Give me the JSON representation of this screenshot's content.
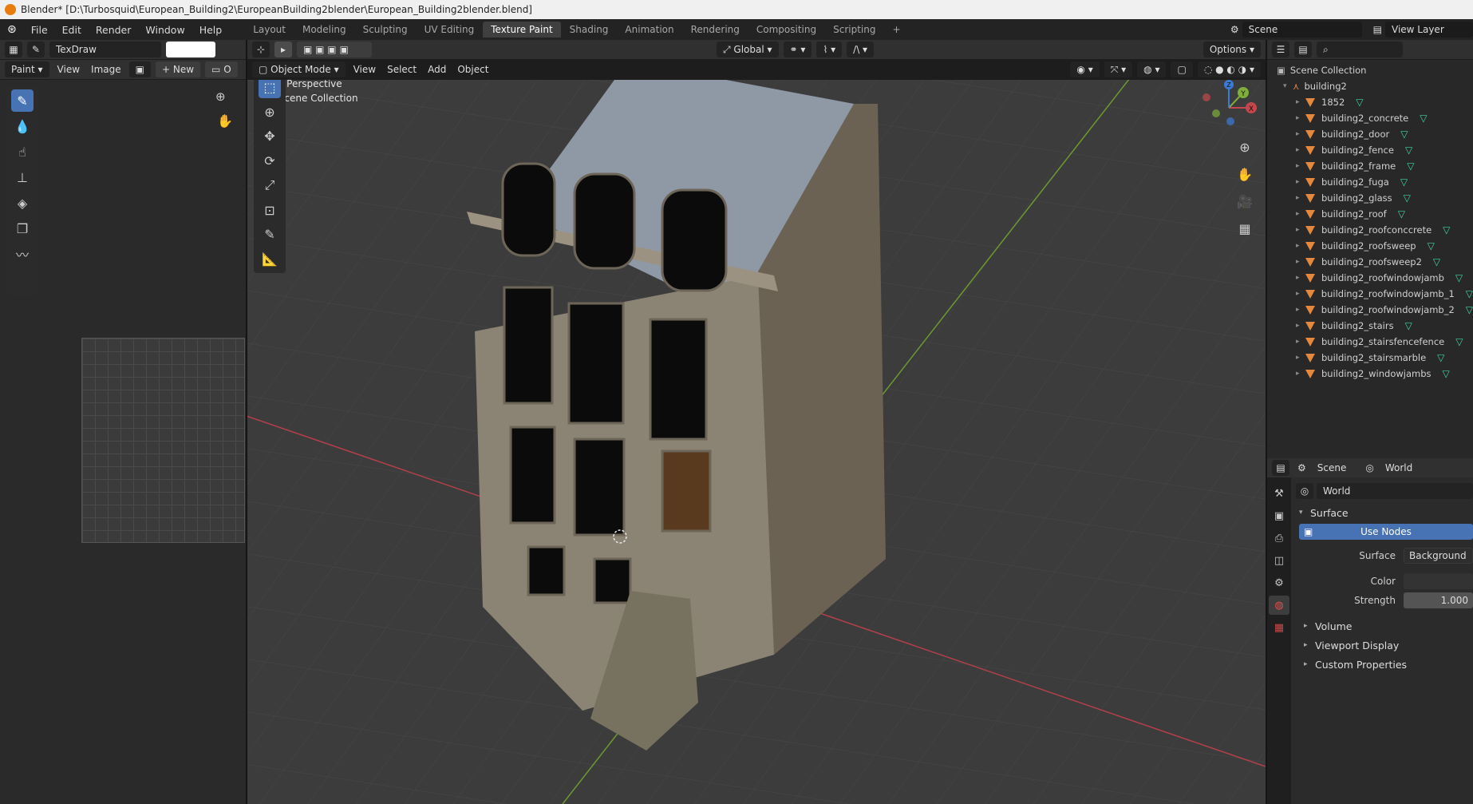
{
  "titlebar": {
    "title": "Blender* [D:\\Turbosquid\\European_Building2\\EuropeanBuilding2blender\\European_Building2blender.blend]"
  },
  "menu": [
    "File",
    "Edit",
    "Render",
    "Window",
    "Help"
  ],
  "workspaces": [
    "Layout",
    "Modeling",
    "Sculpting",
    "UV Editing",
    "Texture Paint",
    "Shading",
    "Animation",
    "Rendering",
    "Compositing",
    "Scripting"
  ],
  "active_workspace": "Texture Paint",
  "scene": {
    "name": "Scene",
    "view_layer": "View Layer"
  },
  "image_editor": {
    "brush_name": "TexDraw",
    "mode": "Paint",
    "menus": [
      "View",
      "Image"
    ],
    "new_label": "New",
    "open_label": "O"
  },
  "viewport": {
    "mode": "Object Mode",
    "menus": [
      "View",
      "Select",
      "Add",
      "Object"
    ],
    "orientation": "Global",
    "options_label": "Options",
    "overlay_line1": "User Perspective",
    "overlay_line2": "(1) Scene Collection",
    "gizmo_axes": [
      "X",
      "Y",
      "Z"
    ]
  },
  "outliner": {
    "root": "Scene Collection",
    "collection": "building2",
    "items": [
      "1852",
      "building2_concrete",
      "building2_door",
      "building2_fence",
      "building2_frame",
      "building2_fuga",
      "building2_glass",
      "building2_roof",
      "building2_roofconccrete",
      "building2_roofsweep",
      "building2_roofsweep2",
      "building2_roofwindowjamb",
      "building2_roofwindowjamb_1",
      "building2_roofwindowjamb_2",
      "building2_stairs",
      "building2_stairsfencefence",
      "building2_stairsmarble",
      "building2_windowjambs"
    ]
  },
  "properties": {
    "breadcrumb_scene": "Scene",
    "breadcrumb_world": "World",
    "world_name": "World",
    "surface_section": "Surface",
    "use_nodes": "Use Nodes",
    "surface_label": "Surface",
    "surface_value": "Background",
    "color_label": "Color",
    "strength_label": "Strength",
    "strength_value": "1.000",
    "sections": [
      "Volume",
      "Viewport Display",
      "Custom Properties"
    ]
  },
  "colors": {
    "accent": "#4772b3",
    "mesh_icon": "#e6873c",
    "x_axis": "#c4474d",
    "y_axis": "#7fae3a",
    "grid": "#3a3a3a"
  }
}
